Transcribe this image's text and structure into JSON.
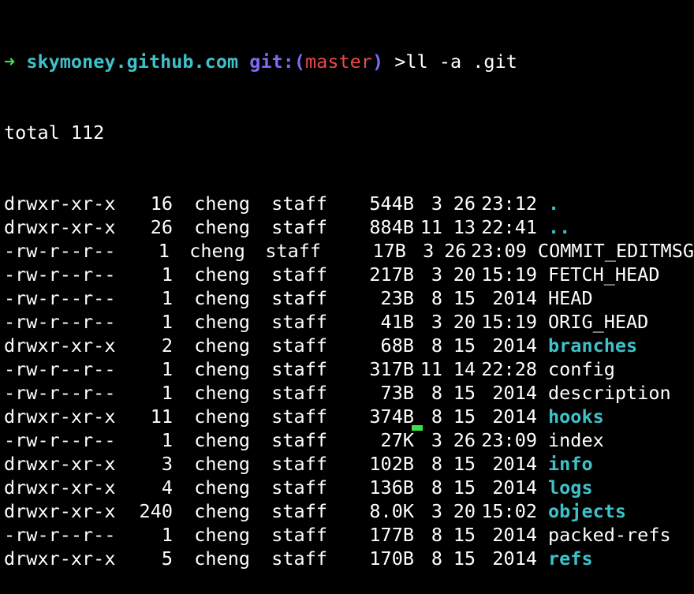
{
  "prompt": {
    "arrow": "➜",
    "host": "skymoney.github.com",
    "git_prefix": "git:(",
    "branch": "master",
    "git_suffix": ")",
    "command": ">ll -a .git"
  },
  "total_line": "total 112",
  "entries": [
    {
      "perm": "drwxr-xr-x",
      "links": "16",
      "user": "cheng",
      "group": "staff",
      "size": "544B",
      "month": "3",
      "day": "26",
      "time": "23:12",
      "name": ".",
      "is_dir": true
    },
    {
      "perm": "drwxr-xr-x",
      "links": "26",
      "user": "cheng",
      "group": "staff",
      "size": "884B",
      "month": "11",
      "day": "13",
      "time": "22:41",
      "name": "..",
      "is_dir": true
    },
    {
      "perm": "-rw-r--r--",
      "links": "1",
      "user": "cheng",
      "group": "staff",
      "size": "17B",
      "month": "3",
      "day": "26",
      "time": "23:09",
      "name": "COMMIT_EDITMSG",
      "is_dir": false
    },
    {
      "perm": "-rw-r--r--",
      "links": "1",
      "user": "cheng",
      "group": "staff",
      "size": "217B",
      "month": "3",
      "day": "20",
      "time": "15:19",
      "name": "FETCH_HEAD",
      "is_dir": false
    },
    {
      "perm": "-rw-r--r--",
      "links": "1",
      "user": "cheng",
      "group": "staff",
      "size": "23B",
      "month": "8",
      "day": "15",
      "time": "2014",
      "name": "HEAD",
      "is_dir": false
    },
    {
      "perm": "-rw-r--r--",
      "links": "1",
      "user": "cheng",
      "group": "staff",
      "size": "41B",
      "month": "3",
      "day": "20",
      "time": "15:19",
      "name": "ORIG_HEAD",
      "is_dir": false
    },
    {
      "perm": "drwxr-xr-x",
      "links": "2",
      "user": "cheng",
      "group": "staff",
      "size": "68B",
      "month": "8",
      "day": "15",
      "time": "2014",
      "name": "branches",
      "is_dir": true
    },
    {
      "perm": "-rw-r--r--",
      "links": "1",
      "user": "cheng",
      "group": "staff",
      "size": "317B",
      "month": "11",
      "day": "14",
      "time": "22:28",
      "name": "config",
      "is_dir": false
    },
    {
      "perm": "-rw-r--r--",
      "links": "1",
      "user": "cheng",
      "group": "staff",
      "size": "73B",
      "month": "8",
      "day": "15",
      "time": "2014",
      "name": "description",
      "is_dir": false
    },
    {
      "perm": "drwxr-xr-x",
      "links": "11",
      "user": "cheng",
      "group": "staff",
      "size": "374B",
      "month": "8",
      "day": "15",
      "time": "2014",
      "name": "hooks",
      "is_dir": true
    },
    {
      "perm": "-rw-r--r--",
      "links": "1",
      "user": "cheng",
      "group": "staff",
      "size": "27K",
      "month": "3",
      "day": "26",
      "time": "23:09",
      "name": "index",
      "is_dir": false
    },
    {
      "perm": "drwxr-xr-x",
      "links": "3",
      "user": "cheng",
      "group": "staff",
      "size": "102B",
      "month": "8",
      "day": "15",
      "time": "2014",
      "name": "info",
      "is_dir": true
    },
    {
      "perm": "drwxr-xr-x",
      "links": "4",
      "user": "cheng",
      "group": "staff",
      "size": "136B",
      "month": "8",
      "day": "15",
      "time": "2014",
      "name": "logs",
      "is_dir": true
    },
    {
      "perm": "drwxr-xr-x",
      "links": "240",
      "user": "cheng",
      "group": "staff",
      "size": "8.0K",
      "month": "3",
      "day": "20",
      "time": "15:02",
      "name": "objects",
      "is_dir": true
    },
    {
      "perm": "-rw-r--r--",
      "links": "1",
      "user": "cheng",
      "group": "staff",
      "size": "177B",
      "month": "8",
      "day": "15",
      "time": "2014",
      "name": "packed-refs",
      "is_dir": false
    },
    {
      "perm": "drwxr-xr-x",
      "links": "5",
      "user": "cheng",
      "group": "staff",
      "size": "170B",
      "month": "8",
      "day": "15",
      "time": "2014",
      "name": "refs",
      "is_dir": true
    }
  ],
  "colors": {
    "background": "#000000",
    "text": "#ffffff",
    "prompt_arrow": "#3ee04a",
    "host": "#3fc1c9",
    "git": "#7e6bf5",
    "branch": "#e84a4a",
    "directory": "#3fc1c9",
    "cursor": "#3ee04a"
  }
}
